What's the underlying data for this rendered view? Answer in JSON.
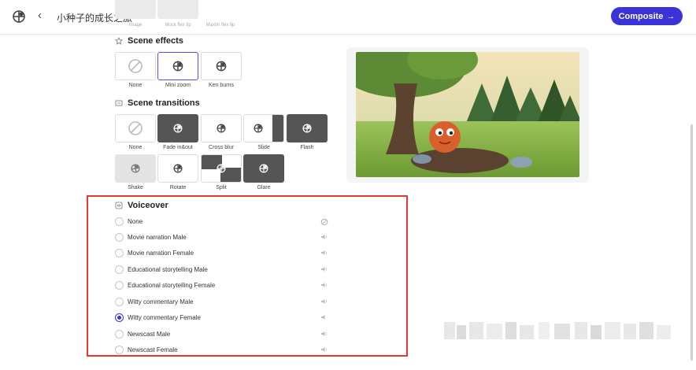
{
  "header": {
    "title": "小种子的成长之旅",
    "composite_label": "Composite",
    "composite_arrow": "→",
    "back_glyph": "‹"
  },
  "top_row": {
    "labels": [
      "Image",
      "Mock flex tip",
      "Maxtin flex tip"
    ]
  },
  "scene_effects": {
    "title": "Scene effects",
    "items": [
      {
        "label": "None",
        "icon": "none-icon"
      },
      {
        "label": "Mini zoom",
        "icon": "logo-icon"
      },
      {
        "label": "Ken burns",
        "icon": "logo-icon"
      }
    ]
  },
  "scene_transitions": {
    "title": "Scene transitions",
    "items": [
      {
        "label": "None"
      },
      {
        "label": "Fade in&out"
      },
      {
        "label": "Cross blur"
      },
      {
        "label": "Slide"
      },
      {
        "label": "Flash"
      },
      {
        "label": "Shake"
      },
      {
        "label": "Rotate"
      },
      {
        "label": "Split"
      },
      {
        "label": "Glare"
      }
    ]
  },
  "voiceover": {
    "title": "Voiceover",
    "options": [
      {
        "label": "None",
        "icon": "ban-icon"
      },
      {
        "label": "Movie narration Male",
        "icon": "speaker-icon"
      },
      {
        "label": "Movie narration Female",
        "icon": "speaker-icon"
      },
      {
        "label": "Educational storytelling Male",
        "icon": "speaker-icon"
      },
      {
        "label": "Educational storytelling Female",
        "icon": "speaker-icon"
      },
      {
        "label": "Witty commentary Male",
        "icon": "speaker-icon"
      },
      {
        "label": "Witty commentary Female",
        "icon": "speaker-icon"
      },
      {
        "label": "Newscast Male",
        "icon": "speaker-icon"
      },
      {
        "label": "Newscast Female",
        "icon": "speaker-icon"
      }
    ],
    "selected": "Witty commentary Female"
  },
  "colors": {
    "accent": "#3b32d8",
    "highlight_border": "#e53935"
  }
}
